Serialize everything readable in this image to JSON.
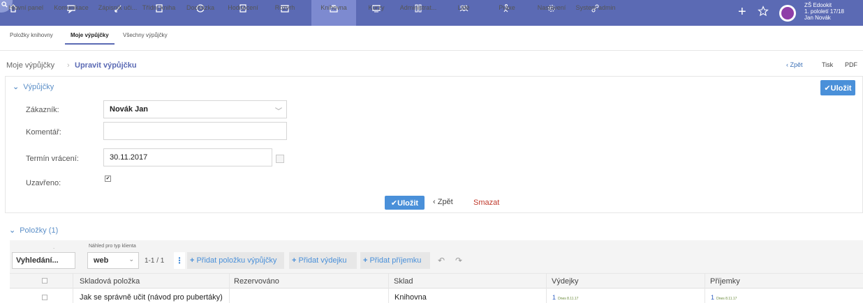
{
  "nav": {
    "items": [
      {
        "label": "Hlavní panel",
        "icon": "home-icon"
      },
      {
        "label": "Komunikace",
        "icon": "chat-icon"
      },
      {
        "label": "Zápisník uči...",
        "icon": "pen-icon"
      },
      {
        "label": "Třídní kniha",
        "icon": "book-icon"
      },
      {
        "label": "Docházka",
        "icon": "clock-icon"
      },
      {
        "label": "Hodnocení",
        "icon": "grade-icon"
      },
      {
        "label": "Rozvrh",
        "icon": "calendar-icon"
      },
      {
        "label": "Knihovna",
        "icon": "library-icon"
      },
      {
        "label": "Kurzy",
        "icon": "course-icon"
      },
      {
        "label": "Administrat...",
        "icon": "admin-icon"
      },
      {
        "label": "Lidé",
        "icon": "people-icon"
      },
      {
        "label": "Praxe",
        "icon": "practice-icon"
      },
      {
        "label": "Nastavení",
        "icon": "gear-icon"
      },
      {
        "label": "System admin",
        "icon": "system-icon"
      }
    ],
    "active": "Knihovna",
    "user": {
      "line1": "ZŠ Edookit",
      "line2": "1. pololetí 17/18",
      "line3": "Jan Novák"
    }
  },
  "subtabs": [
    "Položky knihovny",
    "Moje výpůjčky",
    "Všechny výpůjčky"
  ],
  "breadcrumb": {
    "parent": "Moje výpůjčky",
    "sep": "›",
    "current": "Upravit výpůjčku"
  },
  "top_actions": {
    "back": "‹ Zpět",
    "print": "Tisk",
    "pdf": "PDF"
  },
  "form": {
    "section_title": "Výpůjčky",
    "save_top": "✔Uložit",
    "customer_label": "Zákazník:",
    "customer_value": "Novák Jan",
    "comment_label": "Komentář:",
    "comment_value": "",
    "return_label": "Termín vrácení:",
    "return_value": "30.11.2017",
    "closed_label": "Uzavřeno:",
    "closed_checked": true,
    "save_button": "✔Uložit",
    "back_link": "‹ Zpět",
    "delete_link": "Smazat"
  },
  "items": {
    "title": "Položky (1)",
    "search_value": "Vyhledání...",
    "preview_label": "Náhled pro typ klienta",
    "preview_value": "web",
    "pager": "1-1 / 1",
    "buttons": [
      "Přidat položku výpůjčky",
      "Přidat výdejku",
      "Přidat příjemku"
    ],
    "columns": [
      "Skladová položka",
      "Rezervováno",
      "Sklad",
      "Výdejky",
      "Příjemky"
    ],
    "rows": [
      {
        "item": "Jak se správně učit (návod pro pubertáky)",
        "reserved": "",
        "warehouse": "Knihovna",
        "issues_count": "1",
        "issues_date": "Dnes 8.11.17",
        "receipts_count": "1",
        "receipts_date": "Dnes 8.11.17"
      }
    ]
  },
  "colors": {
    "nav_bg": "#5b6ab4",
    "accent": "#4a90d9",
    "delete": "#c0392b"
  }
}
